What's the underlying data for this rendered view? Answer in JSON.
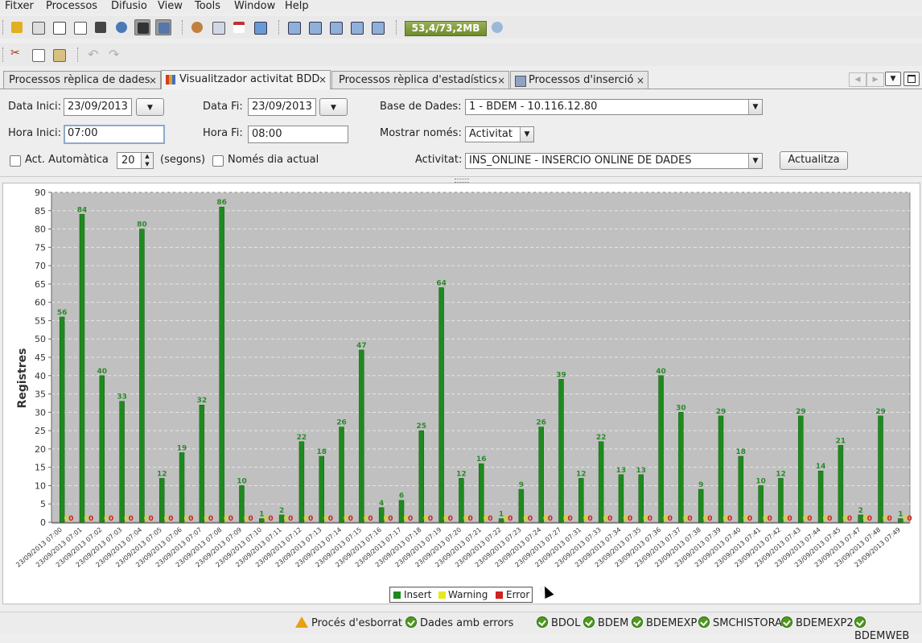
{
  "menu": [
    "Fitxer",
    "Processos",
    "Difusio",
    "View",
    "Tools",
    "Window",
    "Help"
  ],
  "memory": "53,4/73,2MB",
  "tabs": [
    {
      "label": "Processos rèplica de dades"
    },
    {
      "label": "Visualitzador activitat BDD"
    },
    {
      "label": "Processos rèplica d'estadístics"
    },
    {
      "label": "Processos d'inserció"
    }
  ],
  "close_glyph": "×",
  "form": {
    "data_inici_label": "Data Inici:",
    "data_inici": "23/09/2013",
    "data_fi_label": "Data Fi:",
    "data_fi": "23/09/2013",
    "base_label": "Base de Dades:",
    "base": "1 - BDEM - 10.116.12.80",
    "hora_inici_label": "Hora Inici:",
    "hora_inici": "07:00",
    "hora_fi_label": "Hora Fi:",
    "hora_fi": "08:00",
    "mostrar_label": "Mostrar només:",
    "mostrar": "Activitat",
    "act_auto_label": "Act. Automàtica",
    "segons_value": "20",
    "segons_label": "(segons)",
    "nomes_dia_label": "Només dia actual",
    "activitat_label": "Activitat:",
    "activitat": "INS_ONLINE - INSERCIO ONLINE DE DADES",
    "actualitza": "Actualitza"
  },
  "colors": {
    "insert": "#1e8a1e",
    "warning": "#e8e820",
    "error": "#d02020",
    "plot_bg": "#c0c0c0"
  },
  "chart_data": {
    "type": "bar",
    "ylabel": "Registres",
    "ylim": [
      0,
      90
    ],
    "yticks": [
      0,
      5,
      10,
      15,
      20,
      25,
      30,
      35,
      40,
      45,
      50,
      55,
      60,
      65,
      70,
      75,
      80,
      85,
      90
    ],
    "grid": true,
    "legend_position": "bottom",
    "categories": [
      "23/09/2013 07:00",
      "23/09/2013 07:01",
      "23/09/2013 07:02",
      "23/09/2013 07:03",
      "23/09/2013 07:04",
      "23/09/2013 07:05",
      "23/09/2013 07:06",
      "23/09/2013 07:07",
      "23/09/2013 07:08",
      "23/09/2013 07:09",
      "23/09/2013 07:10",
      "23/09/2013 07:11",
      "23/09/2013 07:12",
      "23/09/2013 07:13",
      "23/09/2013 07:14",
      "23/09/2013 07:15",
      "23/09/2013 07:16",
      "23/09/2013 07:17",
      "23/09/2013 07:18",
      "23/09/2013 07:19",
      "23/09/2013 07:20",
      "23/09/2013 07:21",
      "23/09/2013 07:22",
      "23/09/2013 07:23",
      "23/09/2013 07:24",
      "23/09/2013 07:27",
      "23/09/2013 07:31",
      "23/09/2013 07:33",
      "23/09/2013 07:34",
      "23/09/2013 07:35",
      "23/09/2013 07:36",
      "23/09/2013 07:37",
      "23/09/2013 07:38",
      "23/09/2013 07:39",
      "23/09/2013 07:40",
      "23/09/2013 07:41",
      "23/09/2013 07:42",
      "23/09/2013 07:43",
      "23/09/2013 07:44",
      "23/09/2013 07:45",
      "23/09/2013 07:47",
      "23/09/2013 07:48",
      "23/09/2013 07:49"
    ],
    "series": [
      {
        "name": "Insert",
        "values": [
          56,
          84,
          40,
          33,
          80,
          12,
          19,
          32,
          86,
          10,
          1,
          2,
          22,
          18,
          26,
          47,
          4,
          6,
          25,
          64,
          12,
          16,
          1,
          9,
          26,
          39,
          12,
          22,
          13,
          13,
          40,
          30,
          9,
          29,
          18,
          10,
          12,
          29,
          14,
          21,
          2,
          29,
          1
        ]
      },
      {
        "name": "Warning",
        "values": [
          0,
          0,
          0,
          0,
          0,
          0,
          0,
          0,
          0,
          0,
          0,
          0,
          0,
          0,
          0,
          0,
          0,
          0,
          0,
          0,
          0,
          0,
          0,
          0,
          0,
          0,
          0,
          0,
          0,
          0,
          0,
          0,
          0,
          0,
          0,
          0,
          0,
          0,
          0,
          0,
          0,
          0,
          0
        ]
      },
      {
        "name": "Error",
        "values": [
          0,
          0,
          0,
          0,
          0,
          0,
          0,
          0,
          0,
          0,
          0,
          0,
          0,
          0,
          0,
          0,
          0,
          0,
          0,
          0,
          0,
          0,
          0,
          0,
          0,
          0,
          0,
          0,
          0,
          0,
          0,
          0,
          0,
          0,
          0,
          0,
          0,
          0,
          0,
          0,
          0,
          0,
          0
        ]
      }
    ]
  },
  "status": {
    "proces_esborrat": "Procés d'esborrat",
    "dades_errors": "Dades amb errors",
    "databases": [
      "BDOL",
      "BDEM",
      "BDEMEXP",
      "SMCHISTORA",
      "BDEMEXP2",
      "BDEMWEB"
    ]
  }
}
